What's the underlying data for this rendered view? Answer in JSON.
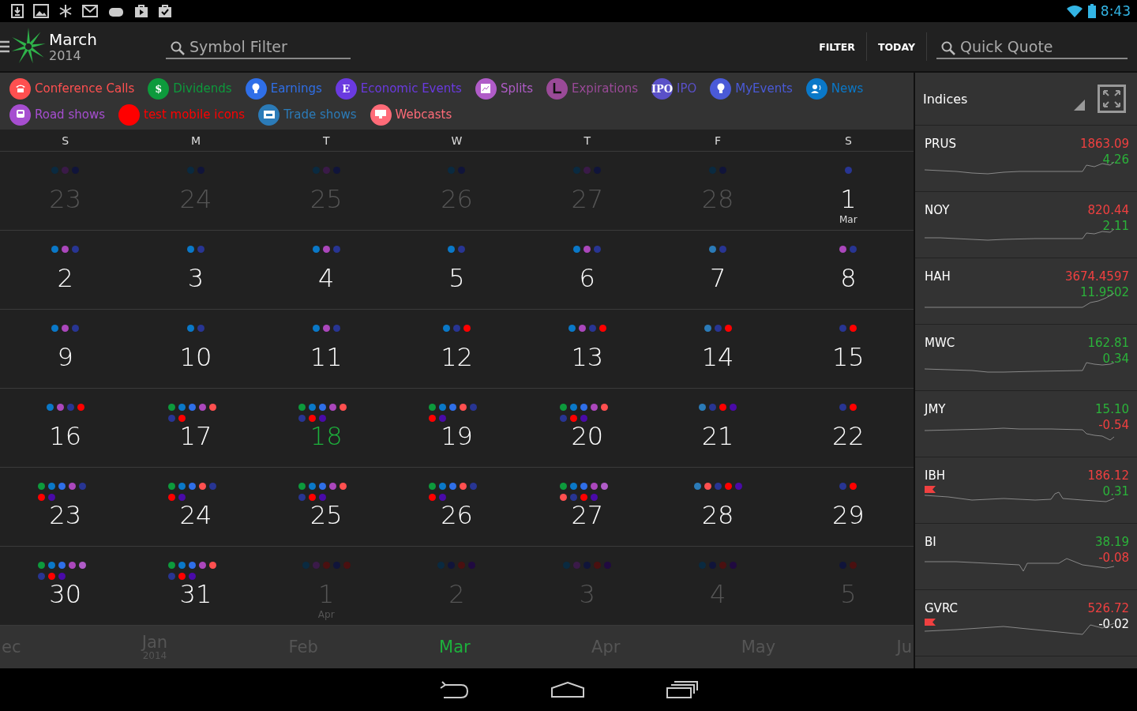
{
  "status_bar": {
    "time": "8:43"
  },
  "header": {
    "month": "March",
    "year": "2014",
    "symbol_filter": {
      "placeholder": "Symbol Filter"
    },
    "actions": [
      "FILTER",
      "TODAY"
    ],
    "quick_quote": {
      "placeholder": "Quick Quote"
    }
  },
  "legend": [
    {
      "label": "Conference Calls",
      "color": "#ff5050",
      "kind": "phone"
    },
    {
      "label": "Dividends",
      "color": "#0d9a3c",
      "kind": "text",
      "icon_text": "$"
    },
    {
      "label": "Earnings",
      "color": "#2f6fe8",
      "kind": "bulb"
    },
    {
      "label": "Economic Events",
      "color": "#6a3ae0",
      "kind": "text",
      "icon_text": "E"
    },
    {
      "label": "Splits",
      "color": "#b05cc8",
      "kind": "chart"
    },
    {
      "label": "Expirations",
      "color": "#9a4a98",
      "kind": "clock"
    },
    {
      "label": "IPO",
      "color": "#5a50c8",
      "kind": "text",
      "icon_text": "IPO"
    },
    {
      "label": "MyEvents",
      "color": "#4a5ad8",
      "kind": "bulb"
    },
    {
      "label": "News",
      "color": "#0a78c8",
      "kind": "person"
    },
    {
      "label": "Road shows",
      "color": "#a64ed0",
      "kind": "bus"
    },
    {
      "label": "test mobile icons",
      "color": "#ff0000",
      "kind": "plain"
    },
    {
      "label": "Trade shows",
      "color": "#2b7bb8",
      "kind": "board"
    },
    {
      "label": "Webcasts",
      "color": "#ff6b78",
      "kind": "monitor"
    }
  ],
  "weekdays": [
    "S",
    "M",
    "T",
    "W",
    "T",
    "F",
    "S"
  ],
  "weeks": [
    [
      {
        "day": "23",
        "in_month": false,
        "today": false,
        "dots": [
          {
            "color": "#0a2a40"
          },
          {
            "color": "#3a1a48"
          },
          {
            "color": "#10143a"
          }
        ]
      },
      {
        "day": "24",
        "in_month": false,
        "today": false,
        "dots": [
          {
            "color": "#0a2a40"
          },
          {
            "color": "#10143a"
          }
        ]
      },
      {
        "day": "25",
        "in_month": false,
        "today": false,
        "dots": [
          {
            "color": "#0a2a40"
          },
          {
            "color": "#3a1a48"
          },
          {
            "color": "#10143a"
          }
        ]
      },
      {
        "day": "26",
        "in_month": false,
        "today": false,
        "dots": [
          {
            "color": "#0a2a40"
          },
          {
            "color": "#10143a"
          }
        ]
      },
      {
        "day": "27",
        "in_month": false,
        "today": false,
        "dots": [
          {
            "color": "#0a2a40"
          },
          {
            "color": "#3a1a48"
          },
          {
            "color": "#10143a"
          }
        ]
      },
      {
        "day": "28",
        "in_month": false,
        "today": false,
        "dots": [
          {
            "color": "#0a2a40"
          },
          {
            "color": "#10143a"
          }
        ]
      },
      {
        "day": "1",
        "month_label": "Mar",
        "in_month": true,
        "today": false,
        "dots": [
          {
            "color": "#283593"
          }
        ]
      }
    ],
    [
      {
        "day": "2",
        "in_month": true,
        "today": false,
        "dots": [
          {
            "color": "#0a78c8"
          },
          {
            "color": "#ab47bc"
          },
          {
            "color": "#283593"
          }
        ]
      },
      {
        "day": "3",
        "in_month": true,
        "today": false,
        "dots": [
          {
            "color": "#0a78c8"
          },
          {
            "color": "#283593"
          }
        ]
      },
      {
        "day": "4",
        "in_month": true,
        "today": false,
        "dots": [
          {
            "color": "#0a78c8"
          },
          {
            "color": "#ab47bc"
          },
          {
            "color": "#283593"
          }
        ]
      },
      {
        "day": "5",
        "in_month": true,
        "today": false,
        "dots": [
          {
            "color": "#0a78c8"
          },
          {
            "color": "#283593"
          }
        ]
      },
      {
        "day": "6",
        "in_month": true,
        "today": false,
        "dots": [
          {
            "color": "#0a78c8"
          },
          {
            "color": "#ab47bc"
          },
          {
            "color": "#283593"
          }
        ]
      },
      {
        "day": "7",
        "in_month": true,
        "today": false,
        "dots": [
          {
            "color": "#2b7bb8"
          },
          {
            "color": "#283593"
          }
        ]
      },
      {
        "day": "8",
        "in_month": true,
        "today": false,
        "dots": [
          {
            "color": "#ab47bc"
          },
          {
            "color": "#283593"
          }
        ]
      }
    ],
    [
      {
        "day": "9",
        "in_month": true,
        "today": false,
        "dots": [
          {
            "color": "#0a78c8"
          },
          {
            "color": "#ab47bc"
          },
          {
            "color": "#283593"
          }
        ]
      },
      {
        "day": "10",
        "in_month": true,
        "today": false,
        "dots": [
          {
            "color": "#0a78c8"
          },
          {
            "color": "#283593"
          }
        ]
      },
      {
        "day": "11",
        "in_month": true,
        "today": false,
        "dots": [
          {
            "color": "#0a78c8"
          },
          {
            "color": "#ab47bc"
          },
          {
            "color": "#283593"
          }
        ]
      },
      {
        "day": "12",
        "in_month": true,
        "today": false,
        "dots": [
          {
            "color": "#0a78c8"
          },
          {
            "color": "#283593"
          },
          {
            "color": "#ff0000"
          }
        ]
      },
      {
        "day": "13",
        "in_month": true,
        "today": false,
        "dots": [
          {
            "color": "#0a78c8"
          },
          {
            "color": "#ab47bc"
          },
          {
            "color": "#283593"
          },
          {
            "color": "#ff0000"
          }
        ]
      },
      {
        "day": "14",
        "in_month": true,
        "today": false,
        "dots": [
          {
            "color": "#2b7bb8"
          },
          {
            "color": "#283593"
          },
          {
            "color": "#ff0000"
          }
        ]
      },
      {
        "day": "15",
        "in_month": true,
        "today": false,
        "dots": [
          {
            "color": "#283593"
          },
          {
            "color": "#ff0000"
          }
        ]
      }
    ],
    [
      {
        "day": "16",
        "in_month": true,
        "today": false,
        "dots": [
          {
            "color": "#0a78c8"
          },
          {
            "color": "#ab47bc"
          },
          {
            "color": "#283593"
          },
          {
            "color": "#ff0000"
          }
        ]
      },
      {
        "day": "17",
        "in_month": true,
        "today": false,
        "dots": [
          {
            "color": "#0d9a3c"
          },
          {
            "color": "#0a78c8"
          },
          {
            "color": "#2f6fe8"
          },
          {
            "color": "#ab47bc"
          },
          {
            "color": "#ff5050"
          },
          {
            "color": "#283593"
          },
          {
            "color": "#ff0000"
          }
        ]
      },
      {
        "day": "18",
        "in_month": true,
        "today": true,
        "dots": [
          {
            "color": "#0d9a3c"
          },
          {
            "color": "#0a78c8"
          },
          {
            "color": "#2f6fe8"
          },
          {
            "color": "#ab47bc"
          },
          {
            "color": "#ff5050"
          },
          {
            "color": "#283593"
          },
          {
            "color": "#ff0000"
          },
          {
            "color": "#4a0aa8"
          }
        ]
      },
      {
        "day": "19",
        "in_month": true,
        "today": false,
        "dots": [
          {
            "color": "#0d9a3c"
          },
          {
            "color": "#0a78c8"
          },
          {
            "color": "#2f6fe8"
          },
          {
            "color": "#ff5050"
          },
          {
            "color": "#283593"
          },
          {
            "color": "#ff0000"
          },
          {
            "color": "#4a0aa8"
          }
        ]
      },
      {
        "day": "20",
        "in_month": true,
        "today": false,
        "dots": [
          {
            "color": "#0d9a3c"
          },
          {
            "color": "#0a78c8"
          },
          {
            "color": "#2f6fe8"
          },
          {
            "color": "#ab47bc"
          },
          {
            "color": "#ff5050"
          },
          {
            "color": "#283593"
          },
          {
            "color": "#ff0000"
          },
          {
            "color": "#4a0aa8"
          }
        ]
      },
      {
        "day": "21",
        "in_month": true,
        "today": false,
        "dots": [
          {
            "color": "#2b7bb8"
          },
          {
            "color": "#283593"
          },
          {
            "color": "#ff0000"
          },
          {
            "color": "#4a0aa8"
          }
        ]
      },
      {
        "day": "22",
        "in_month": true,
        "today": false,
        "dots": [
          {
            "color": "#283593"
          },
          {
            "color": "#ff0000"
          }
        ]
      }
    ],
    [
      {
        "day": "23",
        "in_month": true,
        "today": false,
        "dots": [
          {
            "color": "#0d9a3c"
          },
          {
            "color": "#0a78c8"
          },
          {
            "color": "#2f6fe8"
          },
          {
            "color": "#ab47bc"
          },
          {
            "color": "#283593"
          },
          {
            "color": "#ff0000"
          },
          {
            "color": "#4a0aa8"
          }
        ]
      },
      {
        "day": "24",
        "in_month": true,
        "today": false,
        "dots": [
          {
            "color": "#0d9a3c"
          },
          {
            "color": "#0a78c8"
          },
          {
            "color": "#2f6fe8"
          },
          {
            "color": "#ff5050"
          },
          {
            "color": "#283593"
          },
          {
            "color": "#ff0000"
          },
          {
            "color": "#4a0aa8"
          }
        ]
      },
      {
        "day": "25",
        "in_month": true,
        "today": false,
        "dots": [
          {
            "color": "#0d9a3c"
          },
          {
            "color": "#0a78c8"
          },
          {
            "color": "#2f6fe8"
          },
          {
            "color": "#ab47bc"
          },
          {
            "color": "#ff5050"
          },
          {
            "color": "#283593"
          },
          {
            "color": "#ff0000"
          },
          {
            "color": "#4a0aa8"
          }
        ]
      },
      {
        "day": "26",
        "in_month": true,
        "today": false,
        "dots": [
          {
            "color": "#0d9a3c"
          },
          {
            "color": "#0a78c8"
          },
          {
            "color": "#2f6fe8"
          },
          {
            "color": "#ff5050"
          },
          {
            "color": "#283593"
          },
          {
            "color": "#ff0000"
          },
          {
            "color": "#4a0aa8"
          }
        ]
      },
      {
        "day": "27",
        "in_month": true,
        "today": false,
        "dots": [
          {
            "color": "#0d9a3c"
          },
          {
            "color": "#0a78c8"
          },
          {
            "color": "#2f6fe8"
          },
          {
            "color": "#ab47bc"
          },
          {
            "color": "#b05cc8"
          },
          {
            "color": "#ff5050"
          },
          {
            "color": "#283593"
          },
          {
            "color": "#ff0000"
          },
          {
            "color": "#4a0aa8"
          }
        ]
      },
      {
        "day": "28",
        "in_month": true,
        "today": false,
        "dots": [
          {
            "color": "#2b7bb8"
          },
          {
            "color": "#ff5050"
          },
          {
            "color": "#283593"
          },
          {
            "color": "#ff0000"
          },
          {
            "color": "#4a0aa8"
          }
        ]
      },
      {
        "day": "29",
        "in_month": true,
        "today": false,
        "dots": [
          {
            "color": "#283593"
          },
          {
            "color": "#ff0000"
          }
        ]
      }
    ],
    [
      {
        "day": "30",
        "in_month": true,
        "today": false,
        "dots": [
          {
            "color": "#0d9a3c"
          },
          {
            "color": "#0a78c8"
          },
          {
            "color": "#2f6fe8"
          },
          {
            "color": "#ab47bc"
          },
          {
            "color": "#b05cc8"
          },
          {
            "color": "#283593"
          },
          {
            "color": "#ff0000"
          },
          {
            "color": "#4a0aa8"
          }
        ]
      },
      {
        "day": "31",
        "in_month": true,
        "today": false,
        "dots": [
          {
            "color": "#0d9a3c"
          },
          {
            "color": "#0a78c8"
          },
          {
            "color": "#2f6fe8"
          },
          {
            "color": "#ab47bc"
          },
          {
            "color": "#ff5050"
          },
          {
            "color": "#283593"
          },
          {
            "color": "#ff0000"
          },
          {
            "color": "#4a0aa8"
          }
        ]
      },
      {
        "day": "1",
        "month_label": "Apr",
        "in_month": false,
        "today": false,
        "dots": [
          {
            "color": "#0a2a40"
          },
          {
            "color": "#3a1a48"
          },
          {
            "color": "#4a1010"
          },
          {
            "color": "#10143a"
          },
          {
            "color": "#4a1010"
          }
        ]
      },
      {
        "day": "2",
        "in_month": false,
        "today": false,
        "dots": [
          {
            "color": "#0a2a40"
          },
          {
            "color": "#10143a"
          },
          {
            "color": "#4a1010"
          },
          {
            "color": "#200a40"
          }
        ]
      },
      {
        "day": "3",
        "in_month": false,
        "today": false,
        "dots": [
          {
            "color": "#0a2a40"
          },
          {
            "color": "#3a1a48"
          },
          {
            "color": "#10143a"
          },
          {
            "color": "#4a1010"
          },
          {
            "color": "#200a40"
          }
        ]
      },
      {
        "day": "4",
        "in_month": false,
        "today": false,
        "dots": [
          {
            "color": "#0a2a40"
          },
          {
            "color": "#10143a"
          },
          {
            "color": "#4a1010"
          },
          {
            "color": "#200a40"
          }
        ]
      },
      {
        "day": "5",
        "in_month": false,
        "today": false,
        "dots": [
          {
            "color": "#10143a"
          },
          {
            "color": "#4a1010"
          }
        ]
      }
    ]
  ],
  "month_strip": [
    {
      "label": "ec",
      "selected": false
    },
    {
      "label": "Jan",
      "sublabel": "2014",
      "selected": false
    },
    {
      "label": "Feb",
      "selected": false
    },
    {
      "label": "Mar",
      "selected": true
    },
    {
      "label": "Apr",
      "selected": false
    },
    {
      "label": "May",
      "selected": false
    },
    {
      "label": "Ju",
      "selected": false
    }
  ],
  "sidebar": {
    "title": "Indices",
    "quotes": [
      {
        "symbol": "PRUS",
        "price": {
          "text": "1863.09",
          "color": "#f04040"
        },
        "change": {
          "text": "4.26",
          "color": "#2bb33a"
        },
        "flagged": false
      },
      {
        "symbol": "NOY",
        "price": {
          "text": "820.44",
          "color": "#f04040"
        },
        "change": {
          "text": "2.11",
          "color": "#2bb33a"
        },
        "flagged": false
      },
      {
        "symbol": "HAH",
        "price": {
          "text": "3674.4597",
          "color": "#f04040"
        },
        "change": {
          "text": "11.9502",
          "color": "#2bb33a"
        },
        "flagged": false
      },
      {
        "symbol": "MWC",
        "price": {
          "text": "162.81",
          "color": "#2bb33a"
        },
        "change": {
          "text": "0.34",
          "color": "#2bb33a"
        },
        "flagged": false
      },
      {
        "symbol": "JMY",
        "price": {
          "text": "15.10",
          "color": "#2bb33a"
        },
        "change": {
          "text": "-0.54",
          "color": "#f04040"
        },
        "flagged": false
      },
      {
        "symbol": "IBH",
        "price": {
          "text": "186.12",
          "color": "#f04040"
        },
        "change": {
          "text": "0.31",
          "color": "#2bb33a"
        },
        "flagged": true
      },
      {
        "symbol": "BI",
        "price": {
          "text": "38.19",
          "color": "#2bb33a"
        },
        "change": {
          "text": "-0.08",
          "color": "#f04040"
        },
        "flagged": false
      },
      {
        "symbol": "GVRC",
        "price": {
          "text": "526.72",
          "color": "#f04040"
        },
        "change": {
          "text": "-0.02",
          "color": "#ffffff"
        },
        "flagged": true
      }
    ]
  }
}
